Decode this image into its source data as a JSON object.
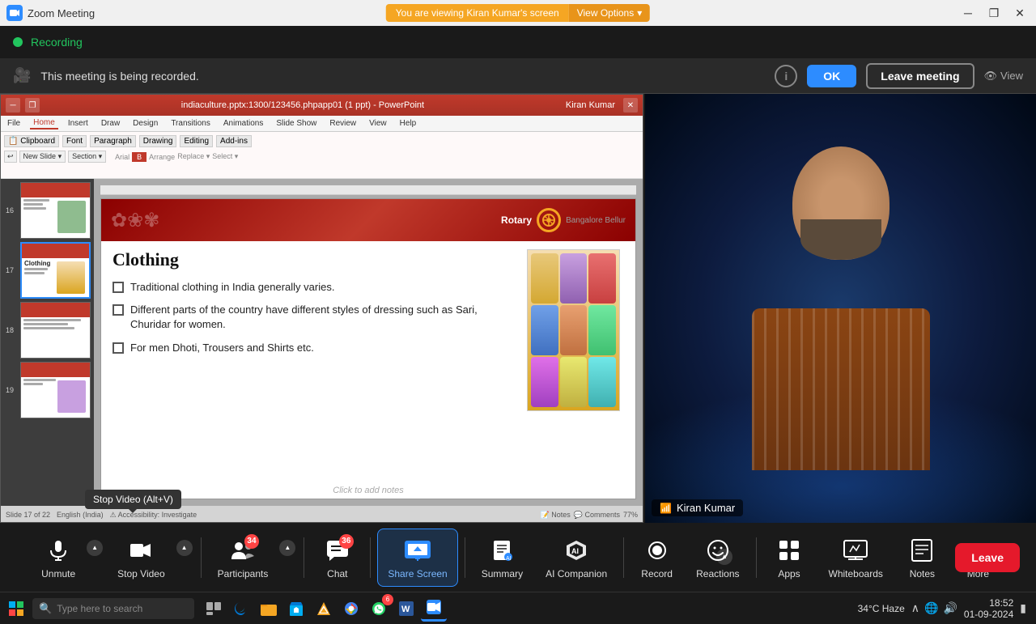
{
  "window": {
    "title": "Zoom Meeting",
    "controls": [
      "minimize",
      "restore",
      "close"
    ]
  },
  "banner": {
    "viewing_text": "You are viewing Kiran Kumar's screen",
    "view_options": "View Options"
  },
  "recording_bar": {
    "indicator_label": "Recording"
  },
  "notice_bar": {
    "message": "This meeting is being recorded.",
    "ok_label": "OK",
    "leave_label": "Leave meeting",
    "view_label": "View"
  },
  "ppt": {
    "title": "indiaculture.pptx:1300/123456.phpapp01 (1 ppt) - PowerPoint",
    "user": "Kiran Kumar",
    "ribbon_tabs": [
      "File",
      "Home",
      "Insert",
      "Draw",
      "Design",
      "Transitions",
      "Animations",
      "Slide Show",
      "Review",
      "View",
      "Help"
    ],
    "active_tab": "Home",
    "slide": {
      "heading": "Clothing",
      "bullets": [
        "Traditional clothing in India generally varies.",
        "Different parts of the country have different styles of dressing such as Sari, Churidar for women.",
        "For men Dhoti, Trousers and Shirts etc."
      ],
      "slide_number": "Slide 17 of 22",
      "language": "English (India)"
    }
  },
  "participant": {
    "name": "Kiran Kumar"
  },
  "toolbar": {
    "buttons": [
      {
        "id": "unmute",
        "label": "Unmute",
        "icon": "mic-icon"
      },
      {
        "id": "stop-video",
        "label": "Stop Video",
        "icon": "video-icon"
      },
      {
        "id": "participants",
        "label": "Participants",
        "icon": "participants-icon",
        "badge": "34"
      },
      {
        "id": "chat",
        "label": "Chat",
        "icon": "chat-icon",
        "badge": "36"
      },
      {
        "id": "share-screen",
        "label": "Share Screen",
        "icon": "share-icon",
        "highlight": true
      },
      {
        "id": "summary",
        "label": "Summary",
        "icon": "summary-icon"
      },
      {
        "id": "ai-companion",
        "label": "AI Companion",
        "icon": "ai-icon"
      },
      {
        "id": "record",
        "label": "Record",
        "icon": "record-icon"
      },
      {
        "id": "reactions",
        "label": "Reactions",
        "icon": "reactions-icon"
      },
      {
        "id": "apps",
        "label": "Apps",
        "icon": "apps-icon"
      },
      {
        "id": "whiteboards",
        "label": "Whiteboards",
        "icon": "whiteboards-icon"
      },
      {
        "id": "notes",
        "label": "Notes",
        "icon": "notes-icon"
      },
      {
        "id": "more",
        "label": "More",
        "icon": "more-icon"
      }
    ],
    "leave_label": "Leave",
    "tooltip": "Stop Video (Alt+V)"
  },
  "taskbar": {
    "search_placeholder": "Type here to search",
    "time": "18:52",
    "date": "01-09-2024",
    "weather": "34°C Haze",
    "apps": [
      "start",
      "search",
      "task-view",
      "edge",
      "file-explorer",
      "store",
      "vlc",
      "chrome",
      "whatsapp",
      "word",
      "zoom"
    ]
  }
}
